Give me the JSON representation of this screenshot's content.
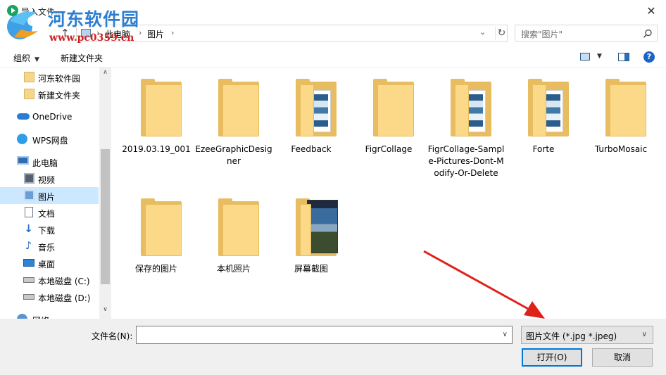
{
  "window": {
    "title": "导入文件...",
    "close_glyph": "✕"
  },
  "watermark": {
    "site_name": "河东软件园",
    "url": "www.pc0359.cn"
  },
  "navigation": {
    "up_glyph": "↑",
    "breadcrumb": [
      "此电脑",
      "图片"
    ],
    "separator": "›",
    "dropdown_glyph": "⌄",
    "refresh_glyph": "↻",
    "search_placeholder": "搜索\"图片\""
  },
  "toolbar": {
    "organize_label": "组织",
    "new_folder_label": "新建文件夹",
    "help_label": "?"
  },
  "sidebar": {
    "items": [
      {
        "label": "河东软件园",
        "icon": "folder-icon"
      },
      {
        "label": "新建文件夹",
        "icon": "folder-icon"
      },
      {
        "label": "OneDrive",
        "icon": "onedrive-icon"
      },
      {
        "label": "WPS网盘",
        "icon": "cloud-icon"
      },
      {
        "label": "此电脑",
        "icon": "computer-icon"
      },
      {
        "label": "视频",
        "icon": "video-icon"
      },
      {
        "label": "图片",
        "icon": "pictures-icon",
        "selected": true
      },
      {
        "label": "文档",
        "icon": "document-icon"
      },
      {
        "label": "下载",
        "icon": "download-icon"
      },
      {
        "label": "音乐",
        "icon": "music-icon"
      },
      {
        "label": "桌面",
        "icon": "desktop-icon"
      },
      {
        "label": "本地磁盘 (C:)",
        "icon": "drive-icon"
      },
      {
        "label": "本地磁盘 (D:)",
        "icon": "drive-icon"
      },
      {
        "label": "网络",
        "icon": "network-icon"
      }
    ],
    "scroll_up_glyph": "∧",
    "scroll_down_glyph": "∨"
  },
  "files": [
    {
      "name": "2019.03.19_001",
      "type": "folder"
    },
    {
      "name": "EzeeGraphicDesigner",
      "type": "folder"
    },
    {
      "name": "Feedback",
      "type": "folder-doc"
    },
    {
      "name": "FigrCollage",
      "type": "folder"
    },
    {
      "name": "FigrCollage-Sample-Pictures-Dont-Modify-Or-Delete",
      "type": "folder-doc"
    },
    {
      "name": "Forte",
      "type": "folder-doc"
    },
    {
      "name": "TurboMosaic",
      "type": "folder"
    },
    {
      "name": "保存的图片",
      "type": "folder"
    },
    {
      "name": "本机照片",
      "type": "folder"
    },
    {
      "name": "屏幕截图",
      "type": "folder-photo"
    }
  ],
  "footer": {
    "filename_label": "文件名(N):",
    "filename_value": "",
    "filetype_value": "图片文件 (*.jpg *.jpeg)",
    "open_label": "打开(O)",
    "cancel_label": "取消",
    "dropdown_glyph": "∨"
  },
  "colors": {
    "selection": "#cce8ff",
    "accent": "#0078d7",
    "annotation_arrow": "#e0201b"
  }
}
